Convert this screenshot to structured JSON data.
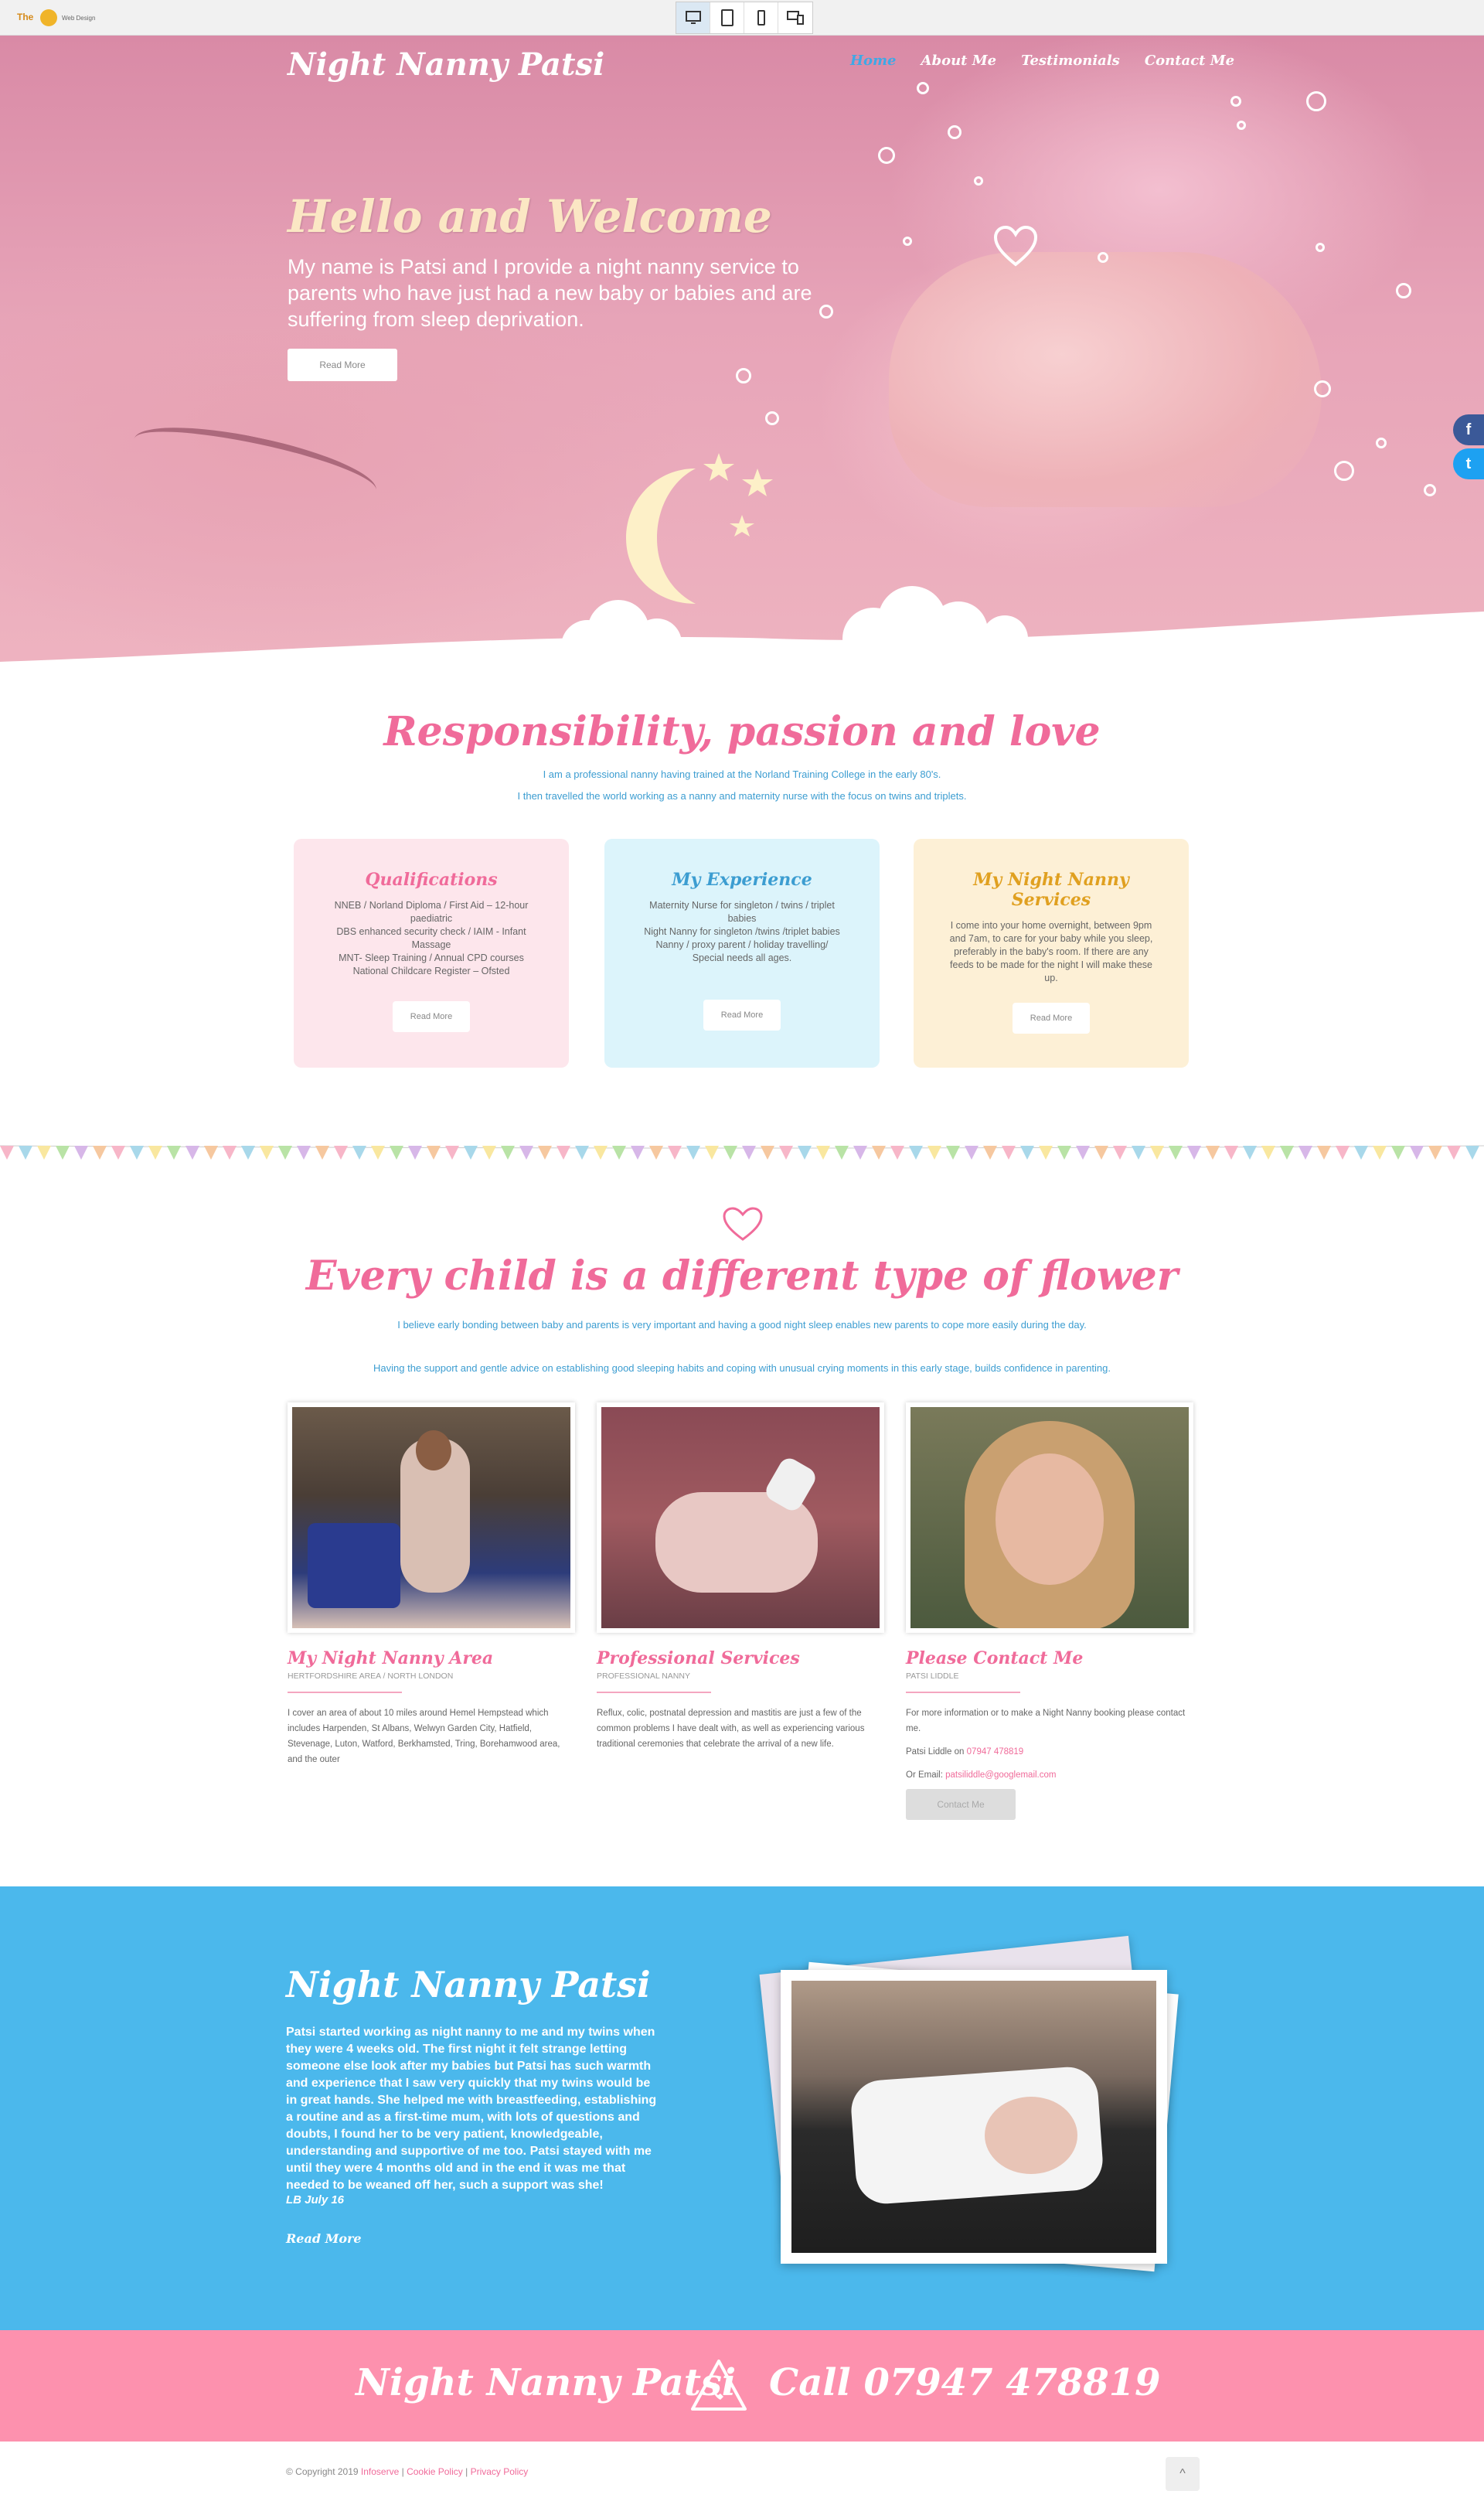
{
  "preview_bar": {
    "logo_text": "The",
    "logo_sub": "Web Design",
    "devices": [
      {
        "name": "desktop",
        "icon": "monitor-icon",
        "active": true
      },
      {
        "name": "tablet",
        "icon": "tablet-icon",
        "active": false
      },
      {
        "name": "phone",
        "icon": "phone-icon",
        "active": false
      },
      {
        "name": "all",
        "icon": "multi-device-icon",
        "active": false
      }
    ]
  },
  "header": {
    "logo": "Night Nanny Patsi",
    "nav": [
      "Home",
      "About Me",
      "Testimonials",
      "Contact Me"
    ],
    "active_nav": "Home"
  },
  "hero": {
    "title": "Hello and Welcome",
    "text": "My name is Patsi and I provide a night nanny service to parents who have just had a new baby or babies and are suffering from sleep deprivation.",
    "button": "Read More"
  },
  "social": [
    "facebook-icon",
    "twitter-icon"
  ],
  "intro": {
    "title": "Responsibility, passion and love",
    "line1": "I am a professional nanny having trained at the Norland Training College in the early 80's.",
    "line2": "I then travelled the world working as a nanny and maternity nurse with the focus on twins and triplets."
  },
  "cards": [
    {
      "title": "Qualifications",
      "text": "NNEB / Norland Diploma / First Aid – 12-hour paediatric\nDBS enhanced security check / IAIM - Infant Massage\nMNT- Sleep Training / Annual CPD courses\nNational Childcare Register – Ofsted",
      "button": "Read More",
      "bg": "#fde6ec",
      "title_color": "#f06b9a"
    },
    {
      "title": "My Experience",
      "text": "Maternity Nurse for singleton / twins / triplet babies\nNight Nanny for singleton /twins /triplet babies\nNanny / proxy parent / holiday travelling/\nSpecial needs all ages.",
      "button": "Read More",
      "bg": "#dcf4fb",
      "title_color": "#3c9dd1"
    },
    {
      "title": "My Night Nanny Services",
      "text": "I come into your home overnight, between 9pm and 7am, to care for your baby while you sleep, preferably in the baby's room. If there are any feeds to be made for the night I will make these up.",
      "button": "Read More",
      "bg": "#fdf0d6",
      "title_color": "#e0a020"
    }
  ],
  "flower": {
    "title": "Every child is a different type of flower",
    "text1": "I believe early bonding between baby and parents is very important and having a good night sleep enables new parents to cope more easily during the day.",
    "text2": "Having the support and gentle advice on establishing good sleeping habits and coping with unusual crying moments in this early stage, builds confidence in parenting."
  },
  "columns": [
    {
      "title": "My Night Nanny Area",
      "sub": "HERTFORDSHIRE AREA / NORTH LONDON",
      "text": "I cover an area of about 10 miles around Hemel Hempstead which includes Harpenden, St Albans, Welwyn Garden City, Hatfield, Stevenage, Luton, Watford, Berkhamsted, Tring, Borehamwood area, and the outer"
    },
    {
      "title": "Professional Services",
      "sub": "PROFESSIONAL NANNY",
      "text": "Reflux, colic, postnatal depression and mastitis are just a few of the common problems I have dealt with, as well as experiencing various traditional ceremonies that celebrate the arrival of a new life."
    },
    {
      "title": "Please Contact Me",
      "sub": "PATSI LIDDLE",
      "text": "For more information or to make a Night Nanny booking please contact me.",
      "phone_label": "Patsi Liddle on",
      "phone": "07947 478819",
      "email_label": "Or Email:",
      "email": "patsiliddle@googlemail.com",
      "button": "Contact Me"
    }
  ],
  "testimonial": {
    "title": "Night Nanny Patsi",
    "text": "Patsi started working as night nanny to me and my twins when they were 4 weeks old. The first night it felt strange letting someone else look after my babies but Patsi has such warmth and experience that I saw very quickly that my twins would be in great hands. She helped me with breastfeeding, establishing a routine and as a first-time mum, with lots of questions and doubts, I found her to be very patient, knowledgeable, understanding and supportive of me too. Patsi stayed with me until they were 4 months old and in the end it was me that needed to be weaned off her, such a support was she!",
    "signature": "LB July 16",
    "link": "Read More"
  },
  "call_band": {
    "name": "Night Nanny Patsi",
    "call": "Call 07947 478819"
  },
  "footer": {
    "copyright": "© Copyright 2019",
    "company": "Infoserve",
    "sep": " | ",
    "cookie": "Cookie Policy",
    "privacy": "Privacy Policy",
    "to_top": "^"
  },
  "colors": {
    "brand_pink": "#f06b9a",
    "brand_blue": "#4bb8ec",
    "call_band": "#fd91ae"
  }
}
